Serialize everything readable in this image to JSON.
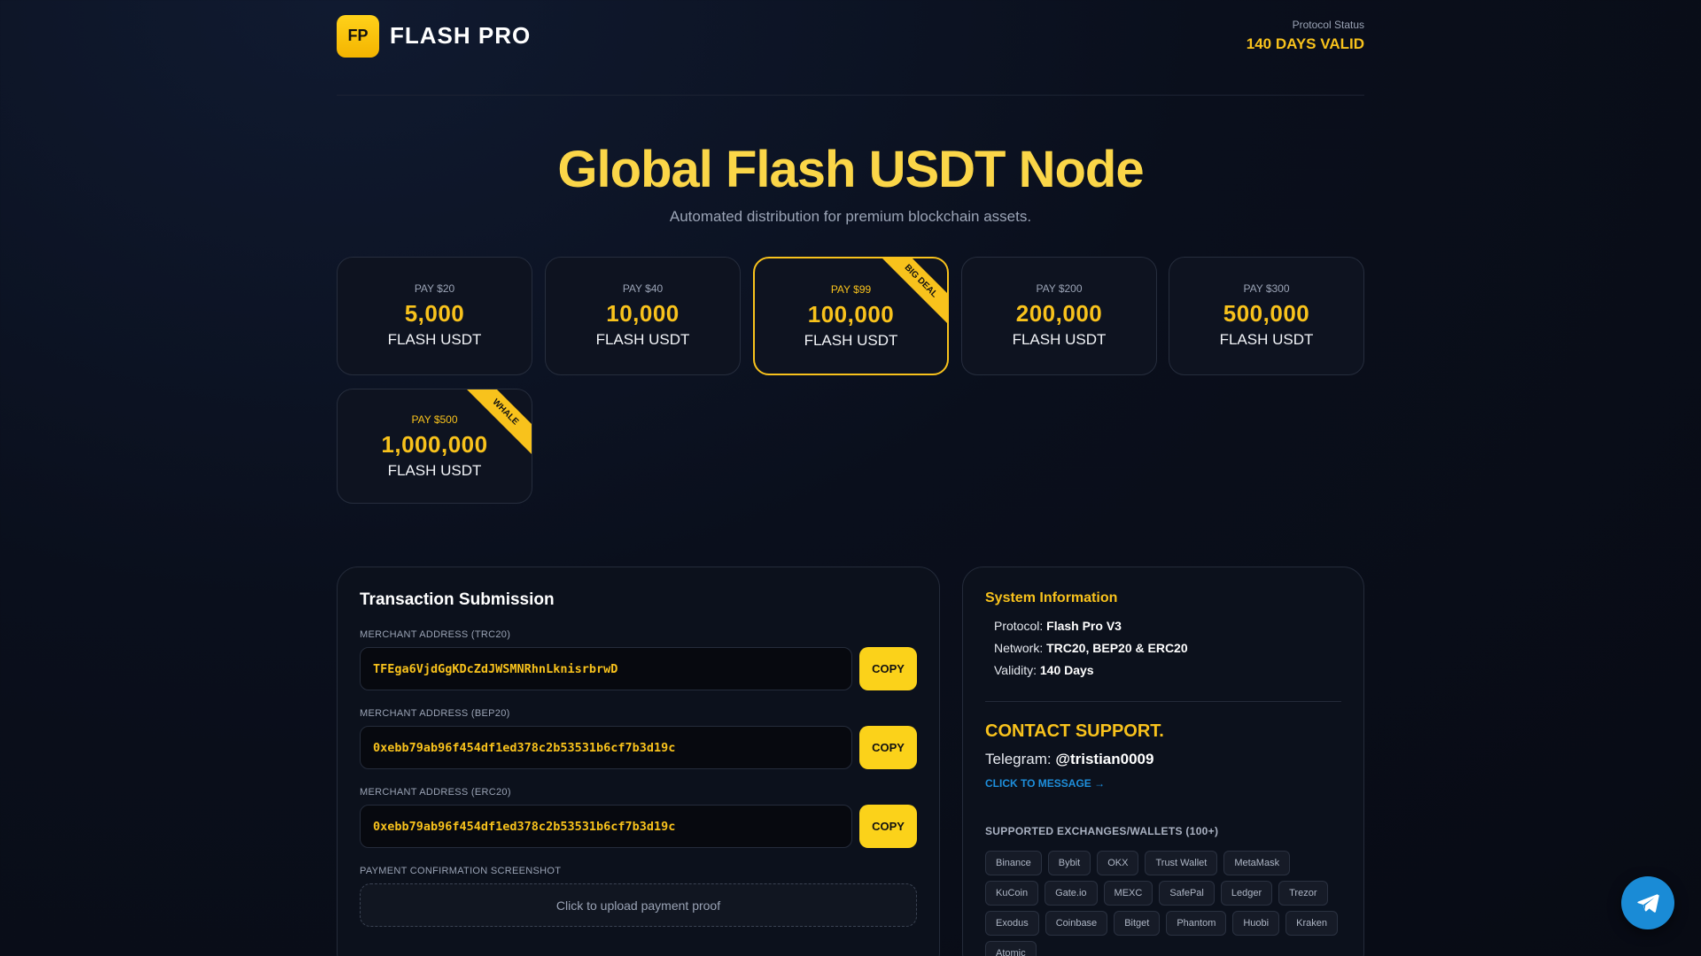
{
  "header": {
    "logo_text": "FP",
    "brand": "FLASH PRO",
    "status_label": "Protocol Status",
    "status_value": "140 DAYS VALID"
  },
  "hero": {
    "title": "Global Flash USDT Node",
    "subtitle": "Automated distribution for premium blockchain assets."
  },
  "packages": [
    {
      "pay": "PAY $20",
      "amount": "5,000",
      "unit": "FLASH USDT"
    },
    {
      "pay": "PAY $40",
      "amount": "10,000",
      "unit": "FLASH USDT"
    },
    {
      "pay": "PAY $99",
      "amount": "100,000",
      "unit": "FLASH USDT",
      "ribbon": "BIG DEAL"
    },
    {
      "pay": "PAY $200",
      "amount": "200,000",
      "unit": "FLASH USDT"
    },
    {
      "pay": "PAY $300",
      "amount": "500,000",
      "unit": "FLASH USDT"
    },
    {
      "pay": "PAY $500",
      "amount": "1,000,000",
      "unit": "FLASH USDT",
      "ribbon": "WHALE"
    }
  ],
  "transaction": {
    "title": "Transaction Submission",
    "trc20_label": "MERCHANT ADDRESS (TRC20)",
    "trc20_value": "TFEga6VjdGgKDcZdJWSMNRhnLknisrbrwD",
    "bep20_label": "MERCHANT ADDRESS (BEP20)",
    "bep20_value": "0xebb79ab96f454df1ed378c2b53531b6cf7b3d19c",
    "erc20_label": "MERCHANT ADDRESS (ERC20)",
    "erc20_value": "0xebb79ab96f454df1ed378c2b53531b6cf7b3d19c",
    "copy_label": "COPY",
    "screenshot_label": "PAYMENT CONFIRMATION SCREENSHOT",
    "upload_text": "Click to upload payment proof"
  },
  "system": {
    "title": "System Information",
    "protocol_label": "Protocol:",
    "protocol_value": "Flash Pro V3",
    "network_label": "Network:",
    "network_value": "TRC20, BEP20 & ERC20",
    "validity_label": "Validity:",
    "validity_value": "140 Days"
  },
  "contact": {
    "title": "CONTACT SUPPORT.",
    "telegram_label": "Telegram:",
    "telegram_handle": "@tristian0009",
    "click_message": "CLICK TO MESSAGE →"
  },
  "exchanges": {
    "title": "SUPPORTED EXCHANGES/WALLETS (100+)",
    "items": [
      "Binance",
      "Bybit",
      "OKX",
      "Trust Wallet",
      "MetaMask",
      "KuCoin",
      "Gate.io",
      "MEXC",
      "SafePal",
      "Ledger",
      "Trezor",
      "Exodus",
      "Coinbase",
      "Bitget",
      "Phantom",
      "Huobi",
      "Kraken",
      "Atomic"
    ]
  },
  "colors": {
    "accent": "#f8c21c",
    "background": "#0a0f1c",
    "telegram_blue": "#1a8bd6"
  }
}
